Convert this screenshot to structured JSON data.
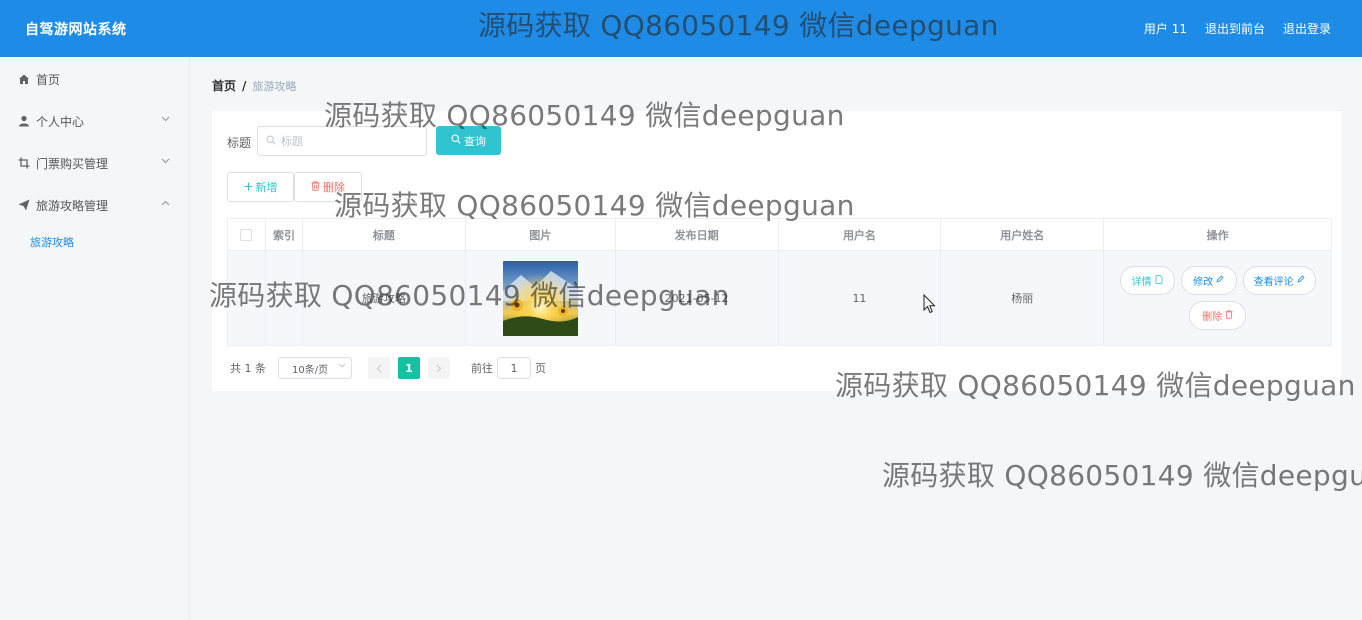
{
  "header": {
    "brand": "自驾游网站系统",
    "user_label": "用户 11",
    "to_front_label": "退出到前台",
    "logout_label": "退出登录"
  },
  "sidebar": {
    "items": [
      {
        "label": "首页",
        "icon": "home-icon"
      },
      {
        "label": "个人中心",
        "icon": "user-icon"
      },
      {
        "label": "门票购买管理",
        "icon": "crop-icon"
      },
      {
        "label": "旅游攻略管理",
        "icon": "paper-plane-icon"
      }
    ],
    "subitem": "旅游攻略"
  },
  "breadcrumb": {
    "home": "首页",
    "separator": "/",
    "current": "旅游攻略"
  },
  "search": {
    "label": "标题",
    "placeholder": "标题",
    "query_label": "查询"
  },
  "actions": {
    "add_label": "新增",
    "delete_label": "删除"
  },
  "table": {
    "headers": [
      "索引",
      "标题",
      "图片",
      "发布日期",
      "用户名",
      "用户姓名",
      "操作"
    ],
    "rows": [
      {
        "title": "旅游攻略",
        "date": "2021-05-12",
        "username": "11",
        "fullname": "杨丽",
        "ops": [
          "详情",
          "修改",
          "查看评论",
          "删除"
        ]
      }
    ]
  },
  "pagination": {
    "total": "共 1 条",
    "page_size": "10条/页",
    "current_page": "1",
    "goto_label": "前往",
    "goto_value": "1",
    "page_unit": "页"
  },
  "watermark": "源码获取 QQ86050149 微信deepguan",
  "colors": {
    "header": "#1e8ce6",
    "accent": "#30c4d1",
    "danger": "#f56c6c",
    "page_active": "#13c2a3"
  }
}
